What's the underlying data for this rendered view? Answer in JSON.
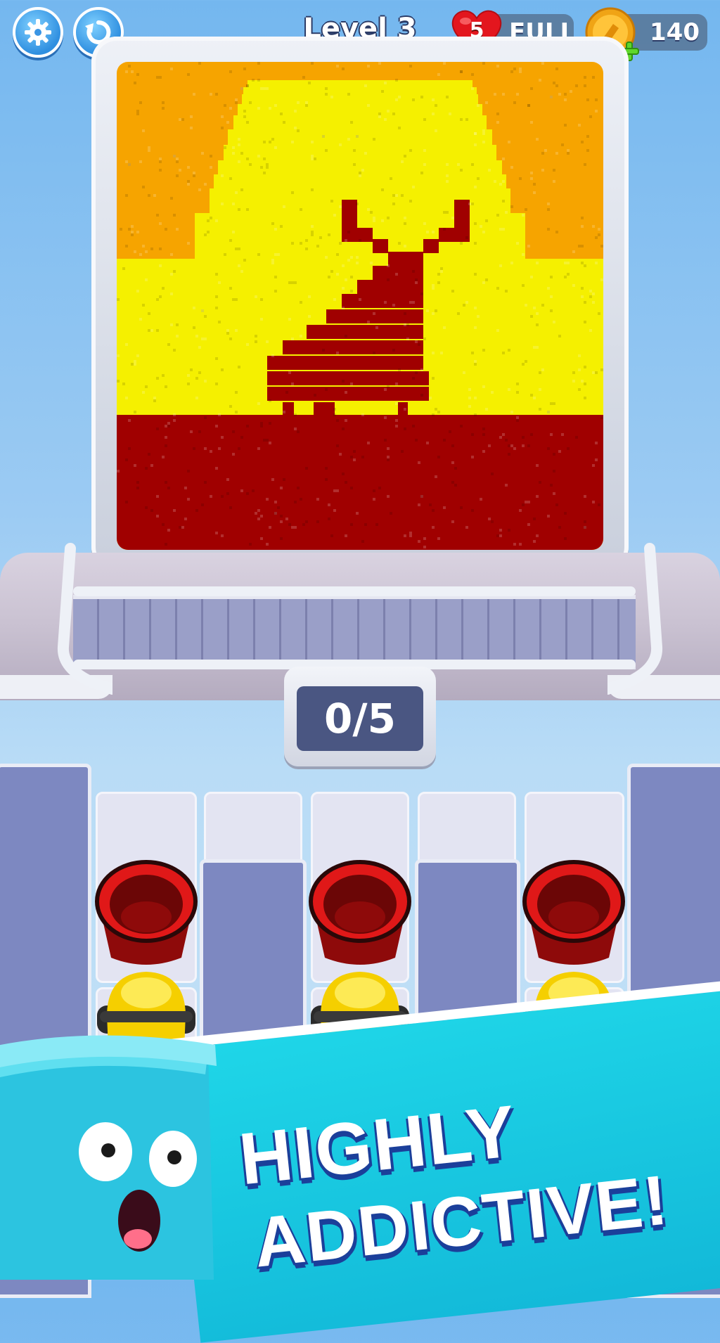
{
  "header": {
    "level_label": "Level 3",
    "lives_count": "5",
    "lives_status": "FULL",
    "coins": "140",
    "icons": [
      "gear-icon",
      "undo-icon",
      "heart-icon",
      "coin-icon",
      "plus-icon"
    ]
  },
  "progress": {
    "counter": "0/5"
  },
  "puzzle": {
    "colors": {
      "sky": "#f6a400",
      "sun": "#f5f000",
      "ground": "#a00000"
    }
  },
  "cannons": {
    "count": 3,
    "colors": [
      "#c81010",
      "#f5d000"
    ]
  },
  "banner": {
    "line1": "HIGHLY",
    "line2": "ADDICTIVE!"
  }
}
